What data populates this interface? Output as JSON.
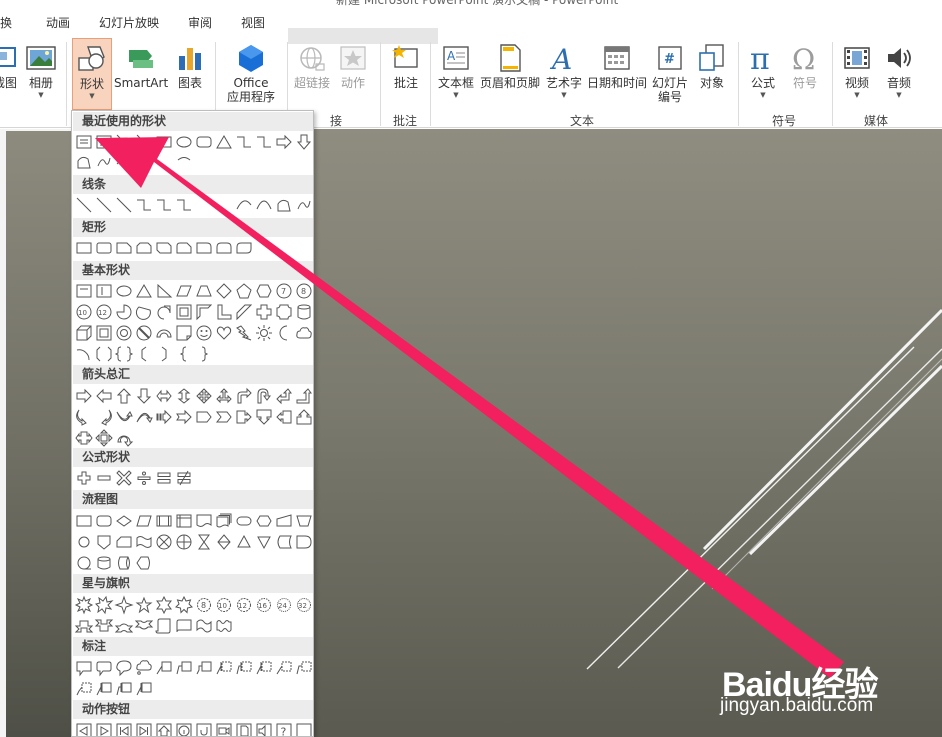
{
  "window": {
    "title_fragment": "新建 Microsoft PowerPoint 演示文稿 - PowerPoint"
  },
  "tabs": [
    "切换",
    "动画",
    "幻灯片放映",
    "审阅",
    "视图"
  ],
  "tabs_visible": [
    "换",
    "动画",
    "幻灯片放映",
    "审阅",
    "视图"
  ],
  "ribbon": {
    "buttons": {
      "screenshot": "截图",
      "album": "相册",
      "shapes": "形状",
      "smartart": "SmartArt",
      "chart": "图表",
      "office_apps_1": "Office",
      "office_apps_2": "应用程序",
      "hyperlink": "超链接",
      "action": "动作",
      "comment": "批注",
      "textbox": "文本框",
      "header_footer": "页眉和页脚",
      "wordart": "艺术字",
      "datetime": "日期和时间",
      "slide_number_1": "幻灯片",
      "slide_number_2": "编号",
      "object": "对象",
      "equation": "公式",
      "symbol": "符号",
      "video": "视频",
      "audio": "音频"
    },
    "groups": {
      "links_partial": "接",
      "comments": "批注",
      "text": "文本",
      "symbols": "符号",
      "media": "媒体"
    }
  },
  "shapes_menu": {
    "sections": [
      {
        "name": "最近使用的形状"
      },
      {
        "name": "线条"
      },
      {
        "name": "矩形"
      },
      {
        "name": "基本形状"
      },
      {
        "name": "箭头总汇"
      },
      {
        "name": "公式形状"
      },
      {
        "name": "流程图"
      },
      {
        "name": "星与旗帜"
      },
      {
        "name": "标注"
      },
      {
        "name": "动作按钮"
      }
    ]
  },
  "watermark": {
    "brand": "Baidu经验",
    "url": "jingyan.baidu.com"
  },
  "colors": {
    "annotation_arrow": "#f2205e",
    "active_button": "#f8d4bf",
    "slide_top": "#8f8d80",
    "slide_bottom": "#5a5a50"
  }
}
